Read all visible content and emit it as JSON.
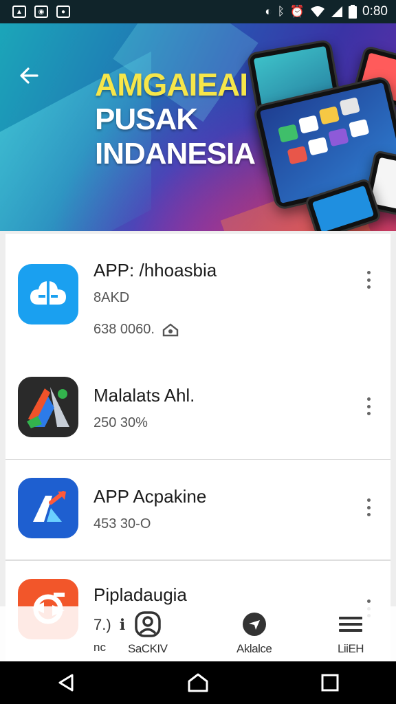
{
  "status_bar": {
    "time": "0:80",
    "icons": [
      "image-icon",
      "instagram-icon",
      "app-icon",
      "moon-icon",
      "bluetooth-icon",
      "alarm-icon",
      "wifi-icon",
      "signal-icon",
      "battery-icon"
    ]
  },
  "banner": {
    "line1": "AMGAIEAI",
    "line2": "PUSAK",
    "line3": "INDANESIA",
    "accent_color": "#f6e64a"
  },
  "apps": [
    {
      "name": "APP: /hhoasbia",
      "sub1": "8AKD",
      "sub2": "638 0060.",
      "icon": "app-cloud-icon",
      "color": "#1aa0f0"
    },
    {
      "name": "Malalats Ahl.",
      "sub1": "250  30%",
      "icon": "app-a-logo-icon",
      "color": "#2a2a2a"
    },
    {
      "name": "APP Acpakine",
      "sub1": "453  30-O",
      "icon": "app-arrow-a-icon",
      "color": "#1e5fd0"
    },
    {
      "name": "Pipladaugia",
      "sub1": "7.)",
      "sub2": "nc",
      "icon": "app-refresh-icon",
      "color": "#f2562a"
    }
  ],
  "bottom_nav": [
    {
      "label": "SaCKIV",
      "icon": "profile-icon"
    },
    {
      "label": "Aklalce",
      "icon": "compass-icon"
    },
    {
      "label": "LiiEH",
      "icon": "menu-icon"
    }
  ]
}
